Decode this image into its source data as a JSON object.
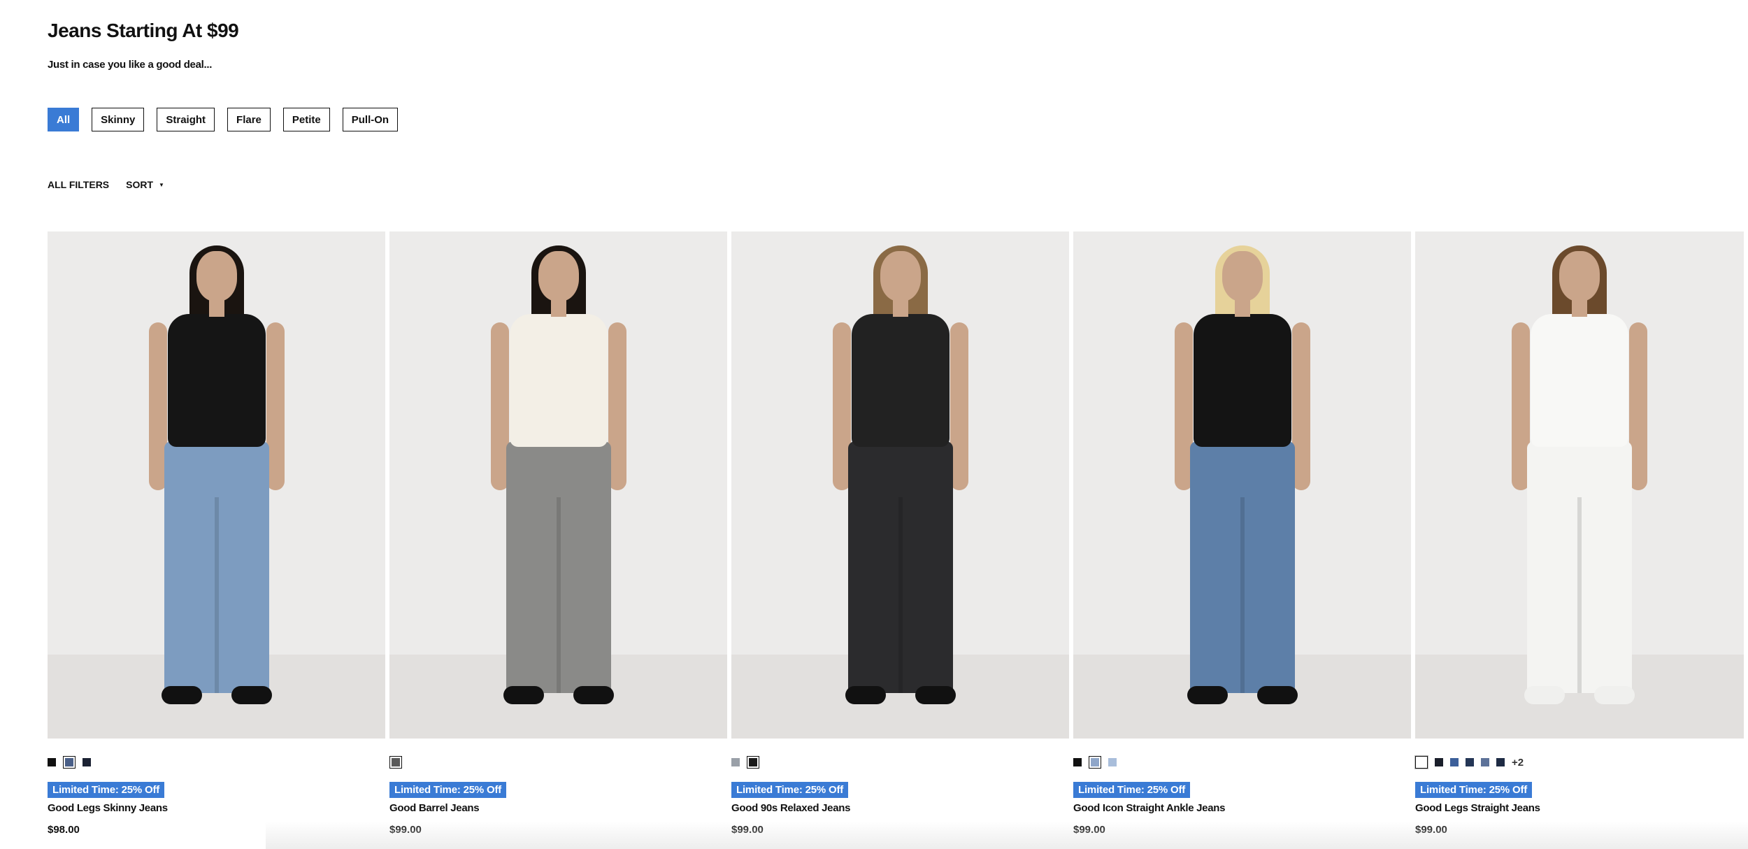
{
  "header": {
    "title": "Jeans Starting At $99",
    "subtitle": "Just in case you like a good deal..."
  },
  "filters": {
    "chips": [
      {
        "label": "All",
        "active": true
      },
      {
        "label": "Skinny",
        "active": false
      },
      {
        "label": "Straight",
        "active": false
      },
      {
        "label": "Flare",
        "active": false
      },
      {
        "label": "Petite",
        "active": false
      },
      {
        "label": "Pull-On",
        "active": false
      }
    ]
  },
  "toolbar": {
    "all_filters_label": "ALL FILTERS",
    "sort_label": "SORT",
    "sort_icon": "caret-down-icon"
  },
  "colors": {
    "accent": "#3a7bd5",
    "photo_background": "#ecebea"
  },
  "products": [
    {
      "name": "Good Legs Skinny Jeans",
      "price": "$98.00",
      "promo": "Limited Time: 25% Off",
      "swatches": [
        "#111111",
        "#4a5f88",
        "#1b2233"
      ],
      "selected_swatch": 1,
      "more_colors": "",
      "top_color": "#151515",
      "pants_color": "#7d9cc0",
      "shoe_color": "#111111",
      "hair_color": "#1a1410"
    },
    {
      "name": "Good Barrel Jeans",
      "price": "$99.00",
      "promo": "Limited Time: 25% Off",
      "swatches": [
        "#5a5a5a"
      ],
      "selected_swatch": 0,
      "more_colors": "",
      "top_color": "#f3efe6",
      "pants_color": "#8a8a88",
      "shoe_color": "#111111",
      "hair_color": "#1a1410"
    },
    {
      "name": "Good 90s Relaxed Jeans",
      "price": "$99.00",
      "promo": "Limited Time: 25% Off",
      "swatches": [
        "#9aa0a8",
        "#1a1a1a"
      ],
      "selected_swatch": 1,
      "more_colors": "",
      "top_color": "#222222",
      "pants_color": "#2b2b2d",
      "shoe_color": "#111111",
      "hair_color": "#8a6a45"
    },
    {
      "name": "Good Icon Straight Ankle Jeans",
      "price": "$99.00",
      "promo": "Limited Time: 25% Off",
      "swatches": [
        "#111111",
        "#8fa6c9",
        "#a9bedb"
      ],
      "selected_swatch": 1,
      "more_colors": "",
      "top_color": "#141414",
      "pants_color": "#5d7fa8",
      "shoe_color": "#111111",
      "hair_color": "#e6d29a"
    },
    {
      "name": "Good Legs Straight Jeans",
      "price": "$99.00",
      "promo": "Limited Time: 25% Off",
      "swatches": [
        "#ffffff",
        "#1a1f2b",
        "#3c5f9a",
        "#243656",
        "#5d7299",
        "#1e2b44"
      ],
      "selected_swatch": 0,
      "more_colors": "+2",
      "top_color": "#f8f8f6",
      "pants_color": "#f4f4f2",
      "shoe_color": "#f0f0ee",
      "hair_color": "#6b4a2c"
    }
  ]
}
